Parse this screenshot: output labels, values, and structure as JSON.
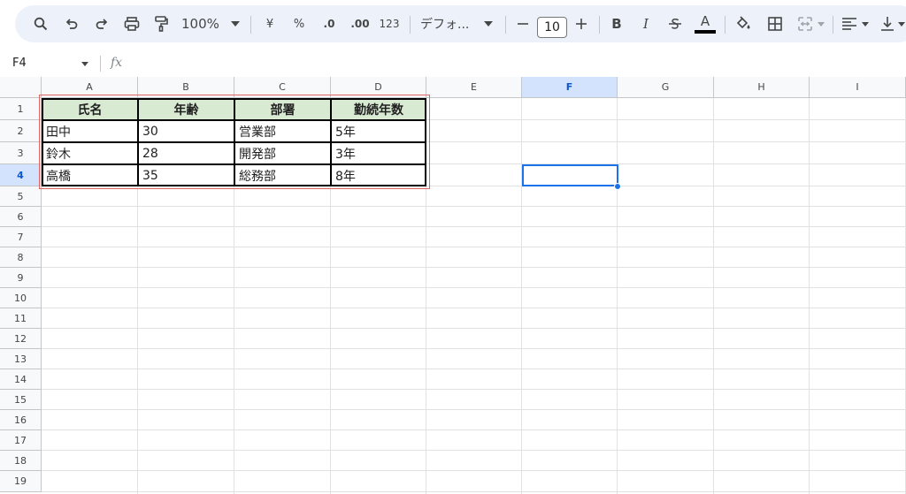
{
  "toolbar": {
    "zoom": "100%",
    "currency": "¥",
    "percent": "%",
    "dec_decrease": ".0",
    "dec_increase": ".00",
    "number_format": "123",
    "font_name": "デフォ...",
    "font_size": "10",
    "bold": "B",
    "italic": "I",
    "text_color": "A"
  },
  "formula_bar": {
    "name_box": "F4",
    "fx": "fx",
    "formula": ""
  },
  "columns": [
    "A",
    "B",
    "C",
    "D",
    "E",
    "F",
    "G",
    "H",
    "I"
  ],
  "rows": [
    "1",
    "2",
    "3",
    "4",
    "5",
    "6",
    "7",
    "8",
    "9",
    "10",
    "11",
    "12",
    "13",
    "14",
    "15",
    "16",
    "17",
    "18",
    "19"
  ],
  "selected": {
    "column": "F",
    "row": "4"
  },
  "table": {
    "headers": [
      "氏名",
      "年齢",
      "部署",
      "勤続年数"
    ],
    "rows": [
      [
        "田中",
        "30",
        "営業部",
        "5年"
      ],
      [
        "鈴木",
        "28",
        "開発部",
        "3年"
      ],
      [
        "高橋",
        "35",
        "総務部",
        "8年"
      ]
    ]
  },
  "colors": {
    "header_fill": "#d9ead3",
    "selection": "#1a73e8",
    "highlight_box": "#e06666"
  }
}
